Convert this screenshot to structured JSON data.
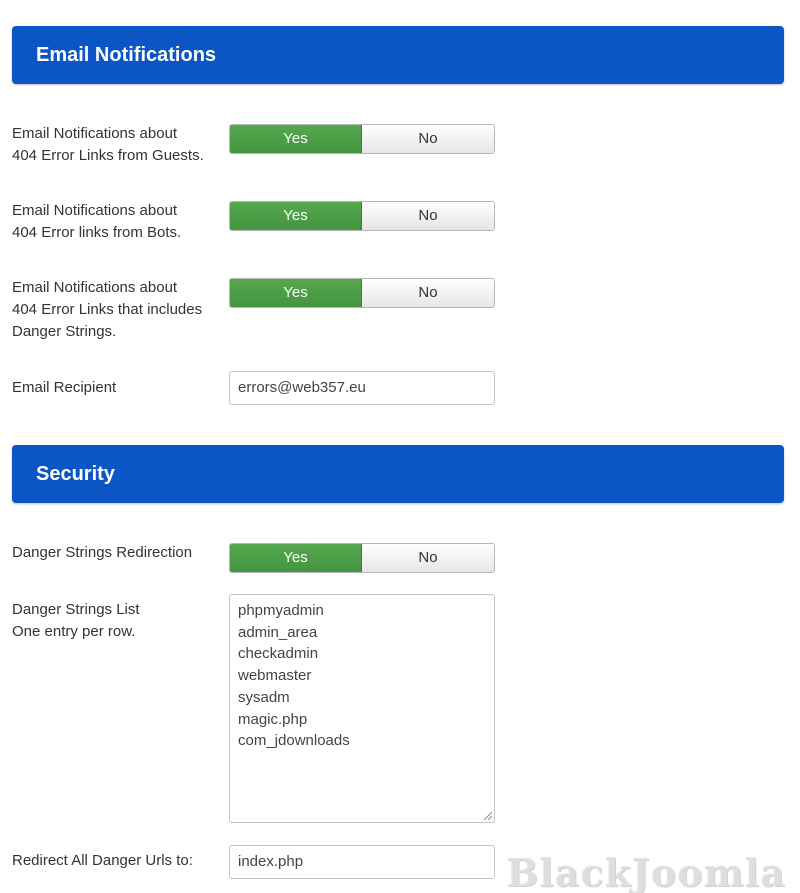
{
  "email_section": {
    "title": "Email Notifications",
    "rows": [
      {
        "label_lines": [
          "Email Notifications about",
          "404 Error Links from Guests."
        ],
        "yes_label": "Yes",
        "no_label": "No",
        "selected": "Yes"
      },
      {
        "label_lines": [
          "Email Notifications about",
          "404 Error links from Bots."
        ],
        "yes_label": "Yes",
        "no_label": "No",
        "selected": "Yes"
      },
      {
        "label_lines": [
          "Email Notifications about",
          "404 Error Links that includes",
          "Danger Strings."
        ],
        "yes_label": "Yes",
        "no_label": "No",
        "selected": "Yes"
      }
    ],
    "recipient": {
      "label": "Email Recipient",
      "value": "errors@web357.eu"
    }
  },
  "security_section": {
    "title": "Security",
    "redirection": {
      "label": "Danger Strings Redirection",
      "yes_label": "Yes",
      "no_label": "No",
      "selected": "Yes"
    },
    "list": {
      "label_lines": [
        "Danger Strings List",
        "One entry per row."
      ],
      "entries": [
        "phpmyadmin",
        "admin_area",
        "checkadmin",
        "webmaster",
        "sysadm",
        "magic.php",
        "com_jdownloads"
      ]
    },
    "redirect_url": {
      "label": "Redirect All Danger Urls to:",
      "value": "index.php"
    }
  },
  "watermark": "BlackJoomla",
  "colors": {
    "header_bg": "#0b56c4",
    "yes_active": "#4c9d45",
    "text": "#333333"
  }
}
